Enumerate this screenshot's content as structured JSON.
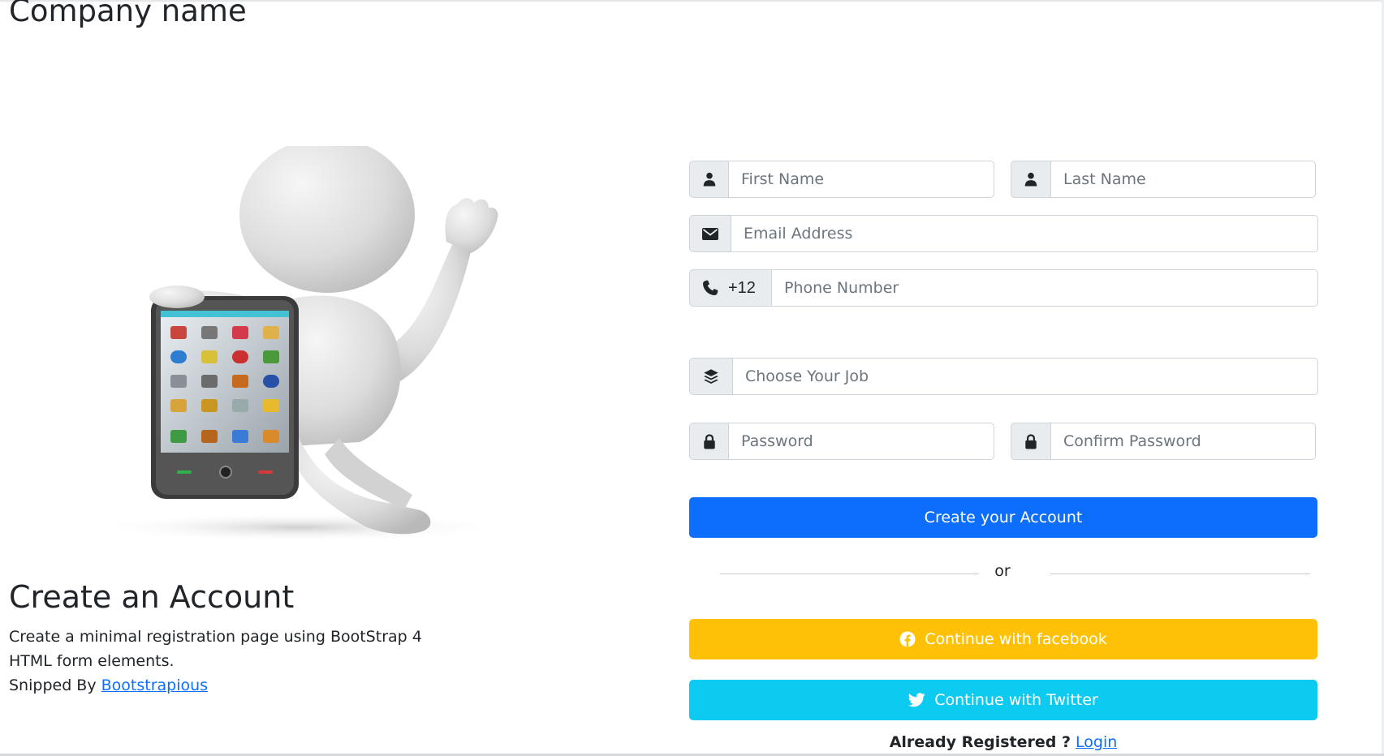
{
  "brand": {
    "name": "Company name"
  },
  "intro": {
    "heading": "Create an Account",
    "line1": "Create a minimal registration page using BootStrap 4",
    "line2": "HTML form elements.",
    "snipped_prefix": "Snipped By",
    "snipped_link": "Bootstrapious"
  },
  "form": {
    "first_name": {
      "placeholder": "First Name",
      "icon": "user-icon"
    },
    "last_name": {
      "placeholder": "Last Name",
      "icon": "user-icon"
    },
    "email": {
      "placeholder": "Email Address",
      "icon": "envelope-icon"
    },
    "phone": {
      "country_code": "+12",
      "placeholder": "Phone Number",
      "icon": "phone-icon"
    },
    "job": {
      "placeholder": "Choose Your Job",
      "icon": "layers-icon"
    },
    "password": {
      "placeholder": "Password",
      "icon": "lock-icon"
    },
    "confirm_password": {
      "placeholder": "Confirm Password",
      "icon": "lock-icon"
    },
    "submit_label": "Create your Account",
    "divider_text": "or",
    "facebook_label": "Continue with facebook",
    "twitter_label": "Continue with Twitter",
    "already_registered": "Already Registered ?",
    "login_link": "Login"
  },
  "colors": {
    "primary": "#0d6efd",
    "warning": "#ffc107",
    "info": "#0dcaf0",
    "addon_background": "#e9ecef",
    "border": "#ced4da"
  }
}
